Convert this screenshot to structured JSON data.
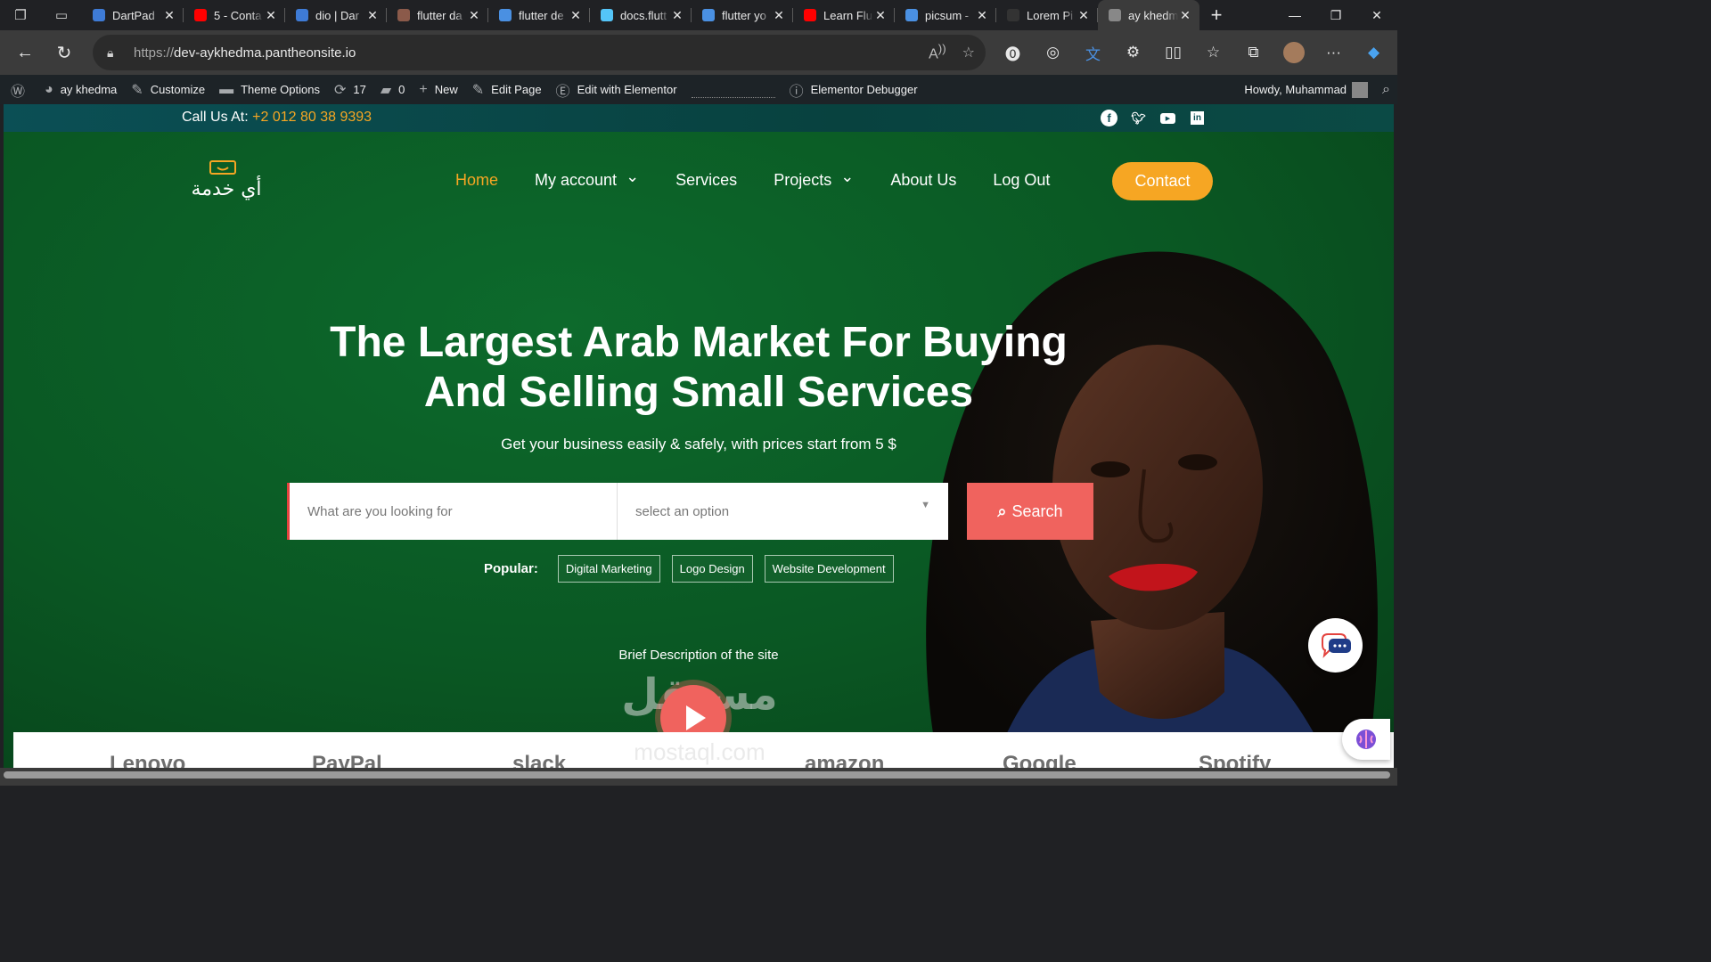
{
  "browser": {
    "tabs": [
      {
        "title": "DartPad",
        "favicon": "dart-icon",
        "color": "#3e7bd6"
      },
      {
        "title": "5 - Conta",
        "favicon": "youtube-icon",
        "color": "#ff0000"
      },
      {
        "title": "dio | Dar",
        "favicon": "dart-icon",
        "color": "#3e7bd6"
      },
      {
        "title": "flutter da",
        "favicon": "pub-icon",
        "color": "#8b5a4a"
      },
      {
        "title": "flutter de",
        "favicon": "search-icon",
        "color": "#4a90e2"
      },
      {
        "title": "docs.flutt",
        "favicon": "flutter-icon",
        "color": "#54c5f8"
      },
      {
        "title": "flutter yo",
        "favicon": "search-icon",
        "color": "#4a90e2"
      },
      {
        "title": "Learn Flu",
        "favicon": "youtube-icon",
        "color": "#ff0000"
      },
      {
        "title": "picsum -",
        "favicon": "search-icon",
        "color": "#4a90e2"
      },
      {
        "title": "Lorem Pi",
        "favicon": "page-icon",
        "color": "#333333"
      },
      {
        "title": "ay khedm",
        "favicon": "site-icon",
        "color": "#888888",
        "active": true
      }
    ],
    "url_scheme": "https://",
    "url_host": "dev-aykhedma.pantheonsite.io"
  },
  "adminbar": {
    "site_name": "ay khedma",
    "customize": "Customize",
    "theme_options": "Theme Options",
    "updates_count": "17",
    "comments_count": "0",
    "new": "New",
    "edit_page": "Edit Page",
    "edit_elementor": "Edit with Elementor",
    "elementor_debugger": "Elementor Debugger",
    "howdy": "Howdy, Muhammad"
  },
  "topbar": {
    "call_label": "Call Us At: ",
    "phone": "+2 012 80 38 9393"
  },
  "site": {
    "logo_text": "أي خدمة",
    "nav": [
      {
        "label": "Home",
        "has_dropdown": false,
        "active": true
      },
      {
        "label": "My account",
        "has_dropdown": true
      },
      {
        "label": "Services",
        "has_dropdown": false
      },
      {
        "label": "Projects",
        "has_dropdown": true
      },
      {
        "label": "About Us",
        "has_dropdown": false
      },
      {
        "label": "Log Out",
        "has_dropdown": false
      }
    ],
    "contact_label": "Contact",
    "accent_color": "#f6a623",
    "cta_color": "#f0635e"
  },
  "hero": {
    "headline_line1": "The Largest Arab Market For Buying",
    "headline_line2": "And Selling Small Services",
    "subline": "Get your business easily & safely, with prices start from 5 $",
    "search_placeholder": "What are you looking for",
    "select_placeholder": "select an option",
    "search_button": "Search",
    "popular_label": "Popular:",
    "popular_tags": [
      "Digital Marketing",
      "Logo Design",
      "Website Development"
    ],
    "brief": "Brief Description of the site"
  },
  "brands": [
    "Lenovo",
    "PayPal",
    "slack",
    "amazon",
    "Google",
    "Spotify"
  ],
  "watermark": {
    "ar": "مستقل",
    "en": "mostaql.com"
  }
}
